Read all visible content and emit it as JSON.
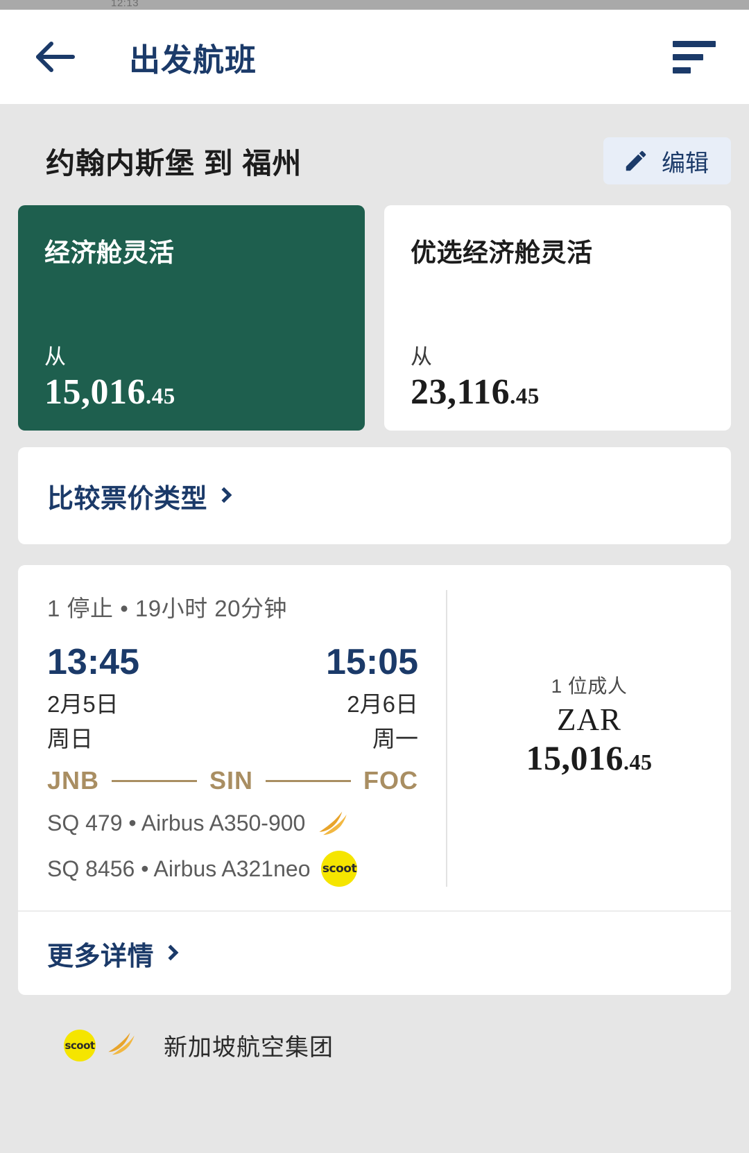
{
  "status_bar": {
    "time": "12:13"
  },
  "appbar": {
    "back_icon": "back-arrow-icon",
    "title": "出发航班",
    "sort_icon": "sort-filter-icon"
  },
  "route_header": {
    "title": "约翰内斯堡 到 福州",
    "edit": {
      "icon": "pencil-icon",
      "label": "编辑"
    }
  },
  "fares": [
    {
      "name": "经济舱灵活",
      "from_label": "从",
      "amount": "15,016",
      "cents": ".45",
      "selected": true
    },
    {
      "name": "优选经济舱灵活",
      "from_label": "从",
      "amount": "23,116",
      "cents": ".45",
      "selected": false
    }
  ],
  "compare": {
    "label": "比较票价类型"
  },
  "flight": {
    "summary": "1 停止 • 19小时 20分钟",
    "depart": {
      "time": "13:45",
      "date": "2月5日",
      "weekday": "周日"
    },
    "arrive": {
      "time": "15:05",
      "date": "2月6日",
      "weekday": "周一"
    },
    "route": {
      "origin": "JNB",
      "stop": "SIN",
      "destination": "FOC"
    },
    "segments": [
      {
        "text": "SQ 479 • Airbus A350-900",
        "logo": "singapore-airlines-bird-icon"
      },
      {
        "text": "SQ 8456 • Airbus A321neo",
        "logo": "scoot-icon"
      }
    ],
    "price": {
      "pax": "1 位成人",
      "currency": "ZAR",
      "amount": "15,016",
      "cents": ".45"
    },
    "more_details": "更多详情"
  },
  "footer": {
    "scoot_logo": "scoot-icon",
    "sia_logo": "singapore-airlines-bird-icon",
    "label": "新加坡航空集团"
  },
  "colors": {
    "brand_navy": "#1b3a69",
    "fare_green": "#1e5f4e",
    "gold": "#a98e62",
    "scoot_yellow": "#f5e500",
    "page_bg": "#e6e6e6"
  }
}
